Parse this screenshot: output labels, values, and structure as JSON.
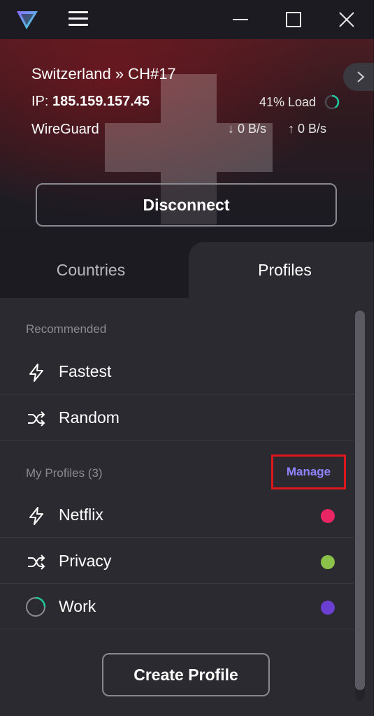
{
  "titlebar": {
    "logo_icon": "protonvpn-logo-icon",
    "menu_icon": "hamburger-menu-icon",
    "minimize_icon": "minimize-icon",
    "maximize_icon": "maximize-icon",
    "close_icon": "close-icon"
  },
  "connection": {
    "title": "Switzerland » CH#17",
    "ip_label": "IP:",
    "ip_value": "185.159.157.45",
    "protocol": "WireGuard",
    "load": "41% Load",
    "load_fraction": 0.41,
    "download_speed": "0 B/s",
    "upload_speed": "0 B/s",
    "disconnect_label": "Disconnect",
    "flag_colors": {
      "red": "#8c141e",
      "cross": "#ffffff"
    }
  },
  "tabs": {
    "countries": "Countries",
    "profiles": "Profiles",
    "active": "profiles"
  },
  "profiles": {
    "recommended_label": "Recommended",
    "recommended": [
      {
        "label": "Fastest",
        "icon": "bolt-icon"
      },
      {
        "label": "Random",
        "icon": "shuffle-icon"
      }
    ],
    "my_profiles_label": "My Profiles (3)",
    "manage_label": "Manage",
    "items": [
      {
        "label": "Netflix",
        "icon": "bolt-icon",
        "color": "#ea2564"
      },
      {
        "label": "Privacy",
        "icon": "shuffle-icon",
        "color": "#8bc34a"
      },
      {
        "label": "Work",
        "icon": "spinner-icon",
        "color": "#6a3fd1"
      }
    ],
    "create_label": "Create Profile"
  },
  "colors": {
    "accent": "#8e84ff",
    "highlight_box": "#e0161e",
    "load_ring": "#1fc79a"
  }
}
